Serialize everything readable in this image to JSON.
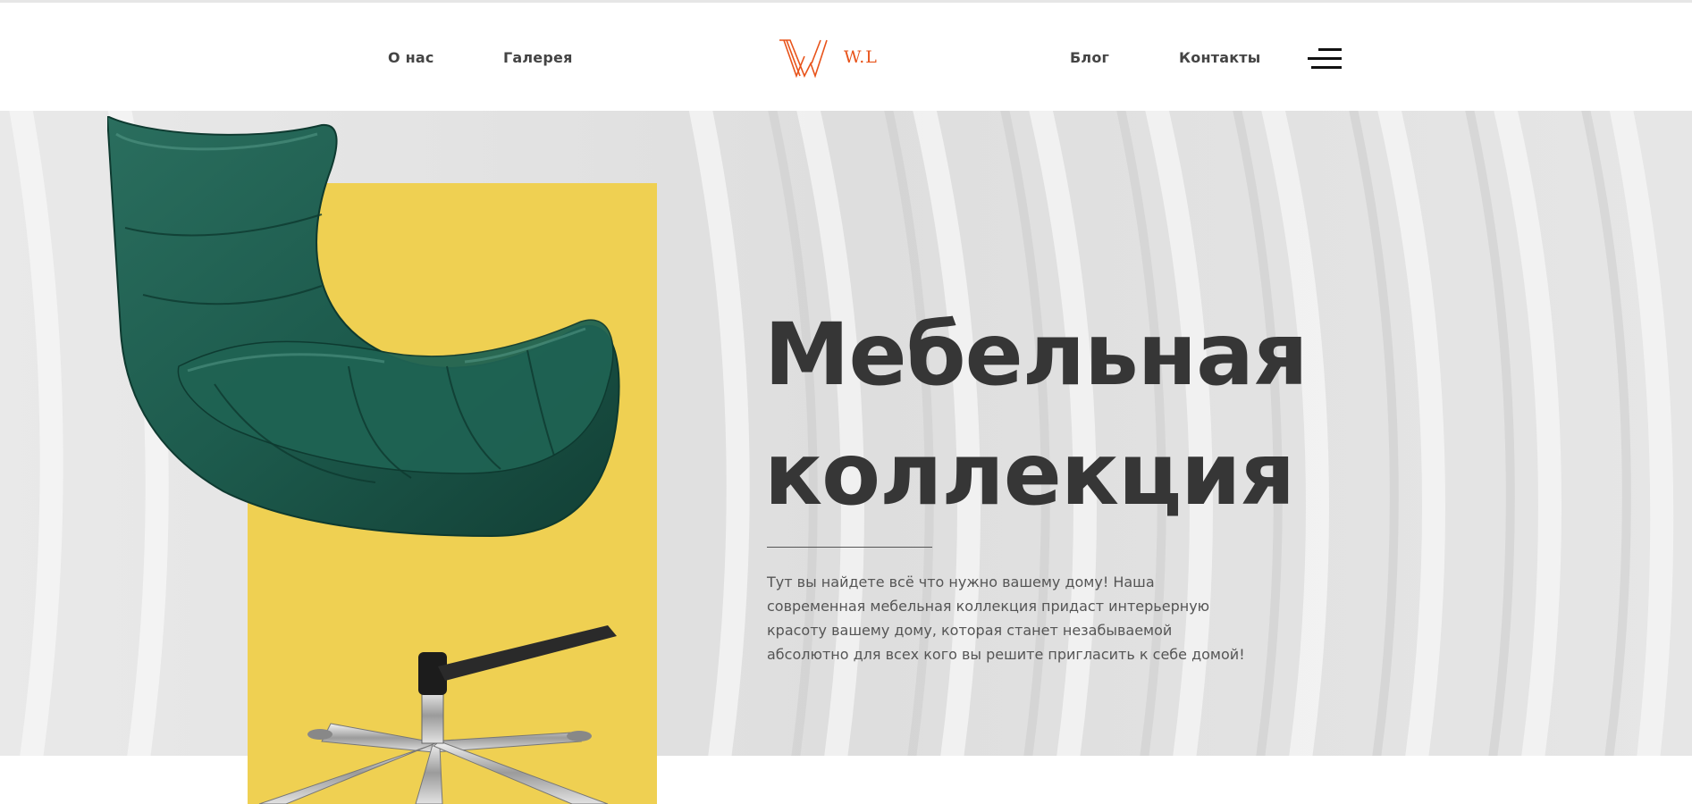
{
  "nav": {
    "about": "О нас",
    "gallery": "Галерея",
    "blog": "Блог",
    "contacts": "Контакты"
  },
  "logo": {
    "mark": "W",
    "text": "W.L"
  },
  "menu": {
    "icon": "hamburger-menu-icon"
  },
  "hero": {
    "title_line1": "Мебельная",
    "title_line2": "коллекция",
    "description": "Тут вы найдете всё что нужно вашему дому! Наша современная мебельная коллекция придаст интерьерную красоту вашему дому, которая станет незабываемой абсолютно для всех кого вы решите пригласить к себе домой!"
  },
  "colors": {
    "brand_accent": "#e8531a",
    "yellow": "#efd052",
    "chair_green": "#1d5b4d",
    "heading": "#363636",
    "body_text": "#555555",
    "hero_background": "#e4e4e4"
  }
}
